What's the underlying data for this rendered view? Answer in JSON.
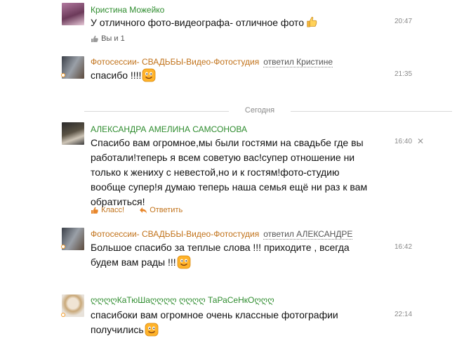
{
  "comments": [
    {
      "author": "Кристина Можейко",
      "text": "У отличного фото-видеографа- отличное фото",
      "time": "20:47",
      "likes": "Вы и 1",
      "avatar_color": "#8a4a6e"
    },
    {
      "author": "Фотосессии- СВАДЬБЫ-Видео-Фотостудия",
      "replied": "ответил Кристине",
      "text": "спасибо !!!!",
      "time": "21:35",
      "avatar_color": "#6b6f78"
    },
    {
      "author": "АЛЕКСАНДРА АМЕЛИНА САМСОНОВА",
      "text_lines": [
        "Спасибо вам огромное,мы были гостями на свадьбе где вы",
        "работали!теперь я всем советую вас!супер отношение ни",
        "только к жениху с невестой,но и к гостям!фото-студию",
        "вообще супер!я думаю теперь наша семья ещё ни раз к вам",
        "обратиться!"
      ],
      "time": "16:40",
      "like_label": "Класс!",
      "reply_label": "Ответить",
      "avatar_color": "#4a4238"
    },
    {
      "author": "Фотосессии- СВАДЬБЫ-Видео-Фотостудия",
      "replied": "ответил АЛЕКСАНДРЕ",
      "text_lines": [
        "Большое спасибо за теплые слова !!! приходите , всегда",
        "будем вам рады !!!"
      ],
      "time": "16:42",
      "avatar_color": "#6b6f78"
    },
    {
      "author": "ღღღღКаТюШаღღღღ ღღღღ ТаРаСеНкОღღღ",
      "text_lines": [
        "спасибоки вам огромное очень классные фотографии",
        "получились"
      ],
      "time": "22:14",
      "avatar_color": "#c9b89a"
    }
  ],
  "divider_label": "Сегодня",
  "close_glyph": "✕",
  "colors": {
    "author_green": "#2e8c2e",
    "author_orange": "#c1721a",
    "presence": "#f59d2a",
    "divider": "#d9d9d9"
  }
}
